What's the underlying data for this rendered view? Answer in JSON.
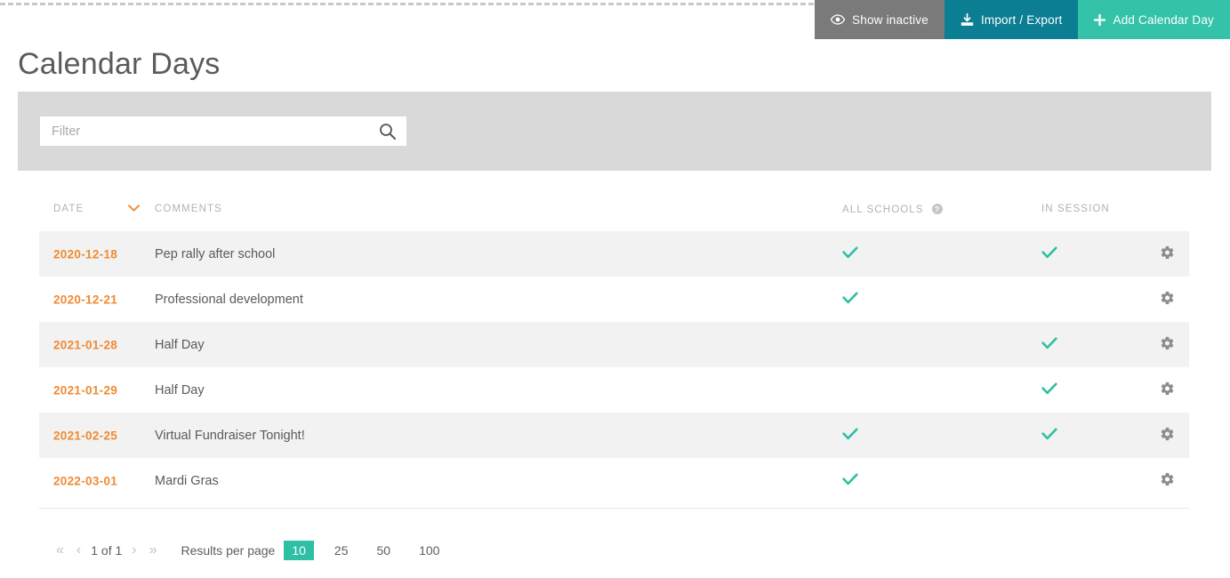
{
  "page": {
    "title": "Calendar Days"
  },
  "actions": [
    {
      "label": "Show inactive",
      "icon": "eye-icon",
      "color": "#7a7a7a"
    },
    {
      "label": "Import / Export",
      "icon": "download-icon",
      "color": "#0b7e93"
    },
    {
      "label": "Add Calendar Day",
      "icon": "plus-icon",
      "color": "#34c2a8"
    }
  ],
  "filter": {
    "placeholder": "Filter",
    "value": "",
    "icon": "search-icon"
  },
  "table": {
    "columns": [
      {
        "key": "date",
        "label": "DATE",
        "sorted": true,
        "sort_dir": "desc"
      },
      {
        "key": "comments",
        "label": "COMMENTS"
      },
      {
        "key": "all_schools",
        "label": "ALL SCHOOLS",
        "help": true
      },
      {
        "key": "in_session",
        "label": "IN SESSION"
      }
    ],
    "rows": [
      {
        "date": "2020-12-18",
        "comments": "Pep rally after school",
        "all_schools": true,
        "in_session": true
      },
      {
        "date": "2020-12-21",
        "comments": "Professional development",
        "all_schools": true,
        "in_session": false
      },
      {
        "date": "2021-01-28",
        "comments": "Half Day",
        "all_schools": false,
        "in_session": true
      },
      {
        "date": "2021-01-29",
        "comments": "Half Day",
        "all_schools": false,
        "in_session": true
      },
      {
        "date": "2021-02-25",
        "comments": "Virtual Fundraiser Tonight!",
        "all_schools": true,
        "in_session": true
      },
      {
        "date": "2022-03-01",
        "comments": "Mardi Gras",
        "all_schools": true,
        "in_session": false
      }
    ],
    "row_action_icon": "gear-icon",
    "check_glyph": "✔"
  },
  "pagination": {
    "first": "«",
    "prev": "‹",
    "page_label": "1 of 1",
    "next": "›",
    "last": "»",
    "results_per_page_label": "Results per page",
    "sizes": [
      "10",
      "25",
      "50",
      "100"
    ],
    "active_size": "10"
  },
  "colors": {
    "accent_orange": "#f08a33",
    "accent_teal": "#2ebfa5",
    "header_teal": "#34c2a8",
    "header_blue": "#0b7e93",
    "header_gray": "#7a7a7a",
    "panel_gray": "#d9d9d9",
    "stripe": "#f2f2f2"
  }
}
